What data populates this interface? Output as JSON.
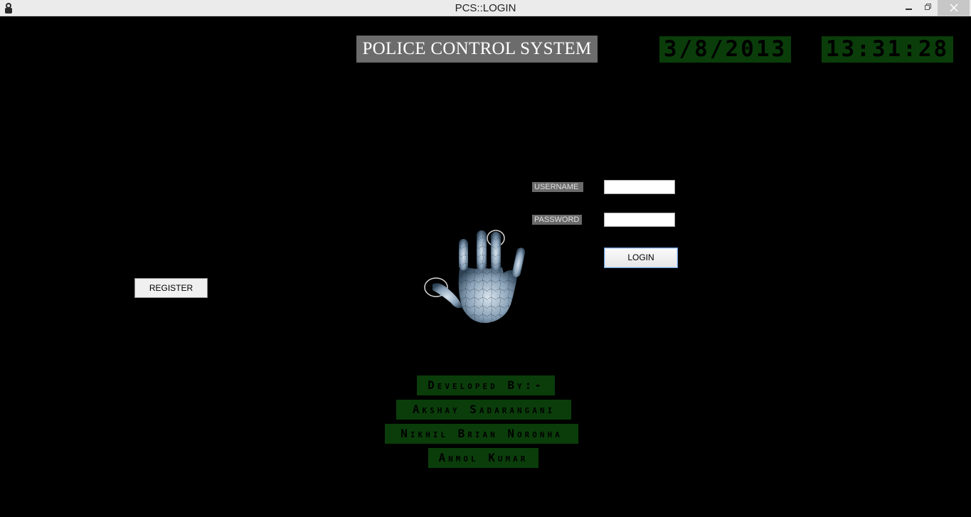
{
  "window": {
    "title": "PCS::LOGIN",
    "icon": "app-icon"
  },
  "header": {
    "title": "POLICE CONTROL SYSTEM",
    "date": "3/8/2013",
    "time": "13:31:28"
  },
  "login_form": {
    "username_label": "USERNAME",
    "username_value": "",
    "password_label": "PASSWORD",
    "password_value": "",
    "login_label": "LOGIN"
  },
  "register": {
    "label": "REGISTER"
  },
  "credits": {
    "heading": "Developed By:-",
    "developers": [
      "Akshay Sadarangani",
      "Nikhil Brian Noronha",
      "Anmol Kumar"
    ]
  },
  "colors": {
    "background": "#000000",
    "title_box": "#6c6c6c",
    "digital_panel": "#0a3d0a",
    "label_box": "#6a6a6a"
  },
  "graphic": {
    "icon": "handprint-icon"
  }
}
